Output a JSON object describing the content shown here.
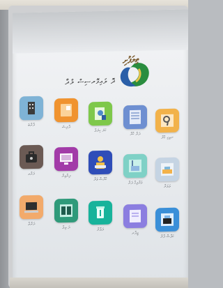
{
  "sign": {
    "logo_text": "ތިލަފުށި",
    "title": "ދޮ ލައިވޮރސިސް ލްދާ"
  },
  "services": [
    {
      "label": "ދާރާބަ",
      "color": "#7fb3d6",
      "icon": "building-icon"
    },
    {
      "label": "ދާރިޝަ",
      "color": "#f0932f",
      "icon": "document-icon"
    },
    {
      "label": "ކަރަ ކިރަލާ",
      "color": "#7ec84a",
      "icon": "search-document-icon"
    },
    {
      "label": "ދަރާ ކާރާ",
      "color": "#6e8fd1",
      "icon": "form-icon"
    },
    {
      "label": "ނވިގި ކާރާ",
      "color": "#f2b24a",
      "icon": "magnifier-icon"
    },
    {
      "label": "ދަރާވ",
      "color": "#6b5a54",
      "icon": "briefcase-icon"
    },
    {
      "label": "ދިރާވިރާ",
      "color": "#a23ba8",
      "icon": "computer-icon"
    },
    {
      "label": "ކާރާޝާ ވަރާ",
      "color": "#2f4db8",
      "icon": "worker-icon"
    },
    {
      "label": "ވަރާލިގާ ދަރާ",
      "color": "#7fd1c6",
      "icon": "crane-icon"
    },
    {
      "label": "ލަލަރާ",
      "color": "#c5d4e3",
      "icon": "warehouse-icon"
    },
    {
      "label": "ދަރާލާ",
      "color": "#f2aa6b",
      "icon": "laptop-icon"
    },
    {
      "label": "ދަ ވިލާ",
      "color": "#2f9a7a",
      "icon": "gate-icon"
    },
    {
      "label": "ދަލާރާ",
      "color": "#17b39b",
      "icon": "recycle-bin-icon"
    },
    {
      "label": "ވީދާރ",
      "color": "#8b7ee0",
      "icon": "certificate-icon"
    },
    {
      "label": "ކަލާޝާ ދާރާ",
      "color": "#3a8fd8",
      "icon": "machinery-icon"
    }
  ]
}
